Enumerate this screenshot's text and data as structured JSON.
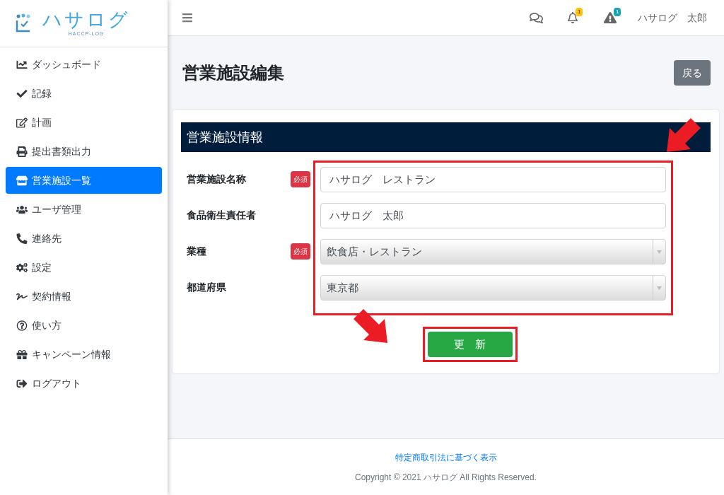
{
  "brand": {
    "name": "ハサログ",
    "subtitle": "HACCP-LOG"
  },
  "sidebar": {
    "items": [
      {
        "label": "ダッシュボード",
        "selected": false
      },
      {
        "label": "記録",
        "selected": false
      },
      {
        "label": "計画",
        "selected": false
      },
      {
        "label": "提出書類出力",
        "selected": false
      },
      {
        "label": "営業施設一覧",
        "selected": true
      },
      {
        "label": "ユーザ管理",
        "selected": false
      },
      {
        "label": "連絡先",
        "selected": false
      },
      {
        "label": "設定",
        "selected": false
      },
      {
        "label": "契約情報",
        "selected": false
      },
      {
        "label": "使い方",
        "selected": false
      },
      {
        "label": "キャンペーン情報",
        "selected": false
      },
      {
        "label": "ログアウト",
        "selected": false
      }
    ]
  },
  "header": {
    "notification_count": "1",
    "alert_count": "1",
    "user": "ハサログ　太郎"
  },
  "page": {
    "title": "営業施設編集",
    "back_button": "戻る"
  },
  "card": {
    "heading": "営業施設情報",
    "fields": [
      {
        "label": "営業施設名称",
        "kind": "text",
        "badge": "必須",
        "value": "ハサログ　レストラン"
      },
      {
        "label": "食品衛生責任者",
        "kind": "text",
        "value": "ハサログ　太郎"
      },
      {
        "label": "業種",
        "kind": "select",
        "badge": "必須",
        "value": "飲食店・レストラン"
      },
      {
        "label": "都道府県",
        "kind": "select",
        "value": "東京都"
      }
    ],
    "submit_button": "更　新"
  },
  "footer": {
    "link": "特定商取引法に基づく表示",
    "copyright": "Copyright © 2021 ハサログ All Rights Reserved."
  }
}
